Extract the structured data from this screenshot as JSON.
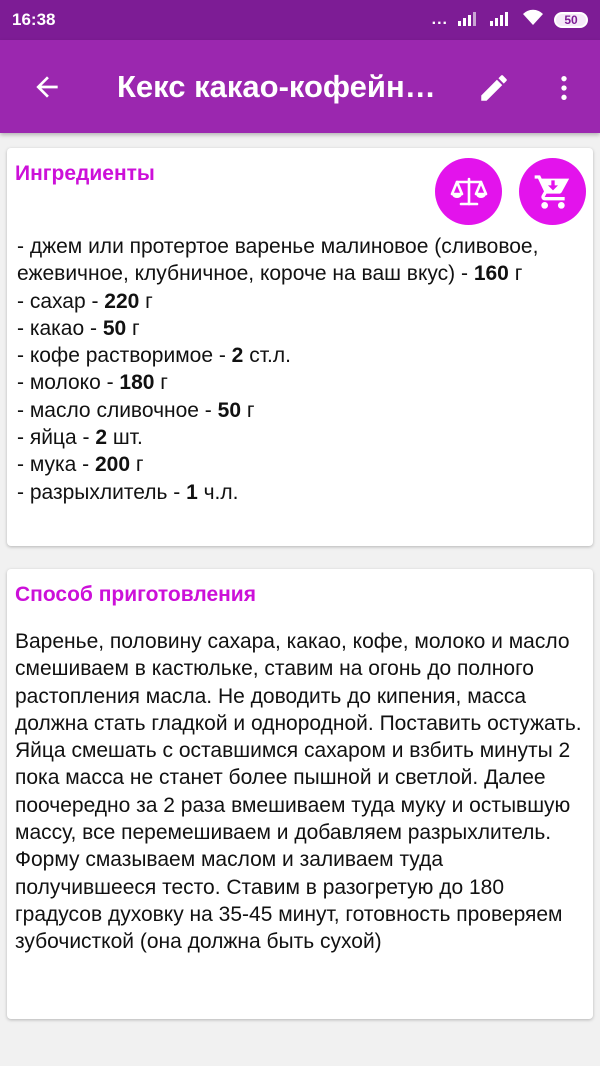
{
  "status": {
    "time": "16:38",
    "dots": "...",
    "battery": "50"
  },
  "appbar": {
    "title": "Кекс какао-кофейный с вареньем"
  },
  "ingredients": {
    "header": "Ингредиенты",
    "items": [
      {
        "name": "- джем или протертое варенье малиновое (сливовое, ежевичное, клубничное, короче на ваш вкус) - ",
        "amount": "160",
        "unit": " г"
      },
      {
        "name": "- сахар - ",
        "amount": "220",
        "unit": " г"
      },
      {
        "name": "- какао - ",
        "amount": "50",
        "unit": " г"
      },
      {
        "name": "- кофе растворимое - ",
        "amount": "2",
        "unit": " ст.л."
      },
      {
        "name": "- молоко - ",
        "amount": "180",
        "unit": " г"
      },
      {
        "name": "- масло сливочное - ",
        "amount": "50",
        "unit": " г"
      },
      {
        "name": "- яйца - ",
        "amount": "2",
        "unit": " шт."
      },
      {
        "name": "- мука - ",
        "amount": "200",
        "unit": " г"
      },
      {
        "name": "- разрыхлитель - ",
        "amount": "1",
        "unit": " ч.л."
      }
    ]
  },
  "preparation": {
    "header": "Способ приготовления",
    "paragraphs": [
      "Варенье, половину сахара, какао, кофе, молоко и масло смешиваем в кастюльке, ставим на огонь до полного растопления масла. Не доводить до кипения, масса должна стать гладкой и однородной. Поставить остужать.",
      "Яйца смешать с оставшимся сахаром и взбить минуты 2 пока масса не станет более пышной и светлой. Далее поочередно за 2 раза вмешиваем туда муку и остывшую массу, все перемешиваем и добавляем разрыхлитель.",
      "Форму смазываем маслом и заливаем туда получившееся тесто. Ставим в разогретую до 180 градусов духовку на 35-45 минут, готовность проверяем зубочисткой (она должна быть сухой)"
    ]
  },
  "icons": {
    "back": "arrow-left-icon",
    "edit": "pencil-icon",
    "more": "more-vert-icon",
    "scale": "scale-icon",
    "cart": "cart-download-icon",
    "signal": "signal-icon",
    "wifi": "wifi-icon"
  },
  "colors": {
    "statusbar": "#7d1c95",
    "appbar": "#9b27af",
    "accent": "#cc10d9",
    "fab": "#e313ec"
  }
}
